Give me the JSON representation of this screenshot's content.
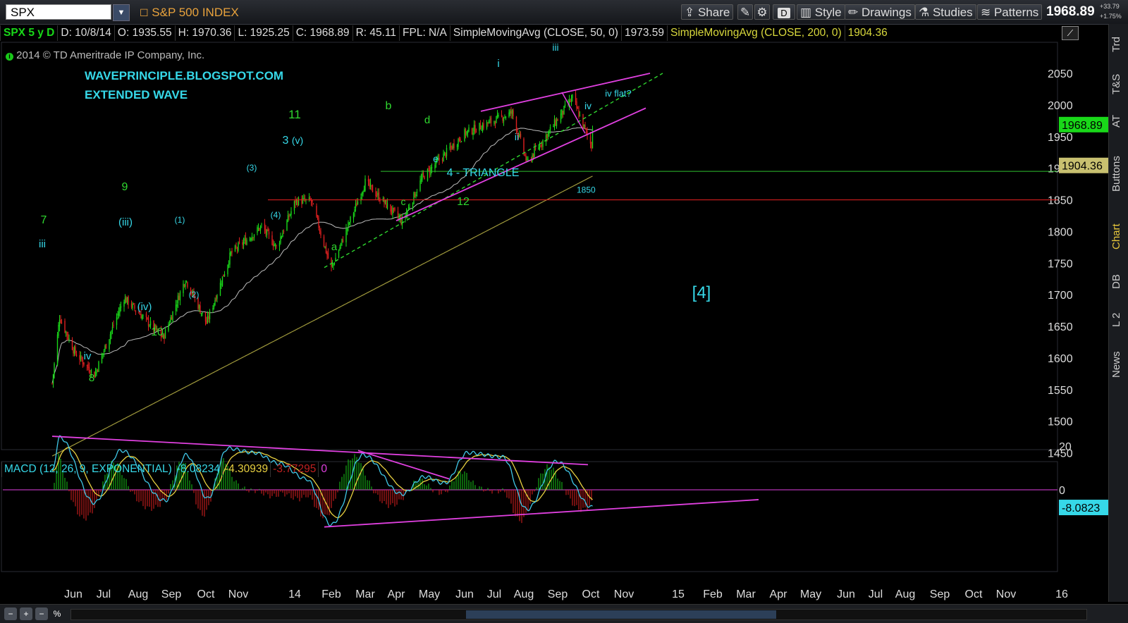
{
  "toolbar": {
    "symbol": "SPX",
    "description": "S&P 500 INDEX",
    "share": "Share",
    "d_badge": "D",
    "style": "Style",
    "drawings": "Drawings",
    "studies": "Studies",
    "patterns": "Patterns",
    "last_price": "1968.89",
    "change_pts": "+33.79",
    "change_pct": "+1.75%"
  },
  "infobar": {
    "symbol": "SPX 5 y D",
    "date": "D: 10/8/14",
    "open": "O: 1935.55",
    "high": "H: 1970.36",
    "low": "L: 1925.25",
    "close": "C: 1968.89",
    "range": "R: 45.11",
    "fpl": "FPL: N/A",
    "sma50_label": "SimpleMovingAvg (CLOSE, 50, 0)",
    "sma50_value": "1973.59",
    "sma200_label": "SimpleMovingAvg (CLOSE, 200, 0)",
    "sma200_value": "1904.36"
  },
  "side_tabs": [
    "Trd",
    "T&S",
    "AT",
    "Buttons",
    "Chart",
    "DB",
    "L 2",
    "News"
  ],
  "colors": {
    "price_up": "#19d819",
    "price_down": "#e02020",
    "sma50": "#bdbdbd",
    "sma200": "#a09a3c",
    "channel": "#e040e0",
    "level_green": "#2fbf2f",
    "level_red": "#d21e1e",
    "wave_green": "#2fd82f",
    "wave_cyan": "#36d8e8",
    "macd_line": "#40c8e8",
    "macd_avg": "#e8d040",
    "macd_hist_up": "#19c819",
    "macd_hist_down": "#e02020"
  },
  "chart_data": {
    "type": "candlestick",
    "title": "",
    "copyright": "2014 © TD Ameritrade IP Company, Inc.",
    "watermark_lines": [
      "WAVEPRINCIPLE.BLOGSPOT.COM",
      "EXTENDED WAVE"
    ],
    "y_ticks": [
      2050,
      2000,
      1950,
      1900,
      1850,
      1800,
      1750,
      1700,
      1650,
      1600,
      1550,
      1500,
      1450
    ],
    "ylim": [
      1410,
      2065
    ],
    "x_ticks": [
      "Jun",
      "Jul",
      "Aug",
      "Sep",
      "Oct",
      "Nov",
      "14",
      "Feb",
      "Mar",
      "Apr",
      "May",
      "Jun",
      "Jul",
      "Aug",
      "Sep",
      "Oct",
      "Nov",
      "15",
      "Feb",
      "Mar",
      "Apr",
      "May",
      "Jun",
      "Jul",
      "Aug",
      "Sep",
      "Oct",
      "Nov",
      "16"
    ],
    "price_path": [
      [
        "2013-05-15",
        1560
      ],
      [
        "2013-05-22",
        1665
      ],
      [
        "2013-06-05",
        1610
      ],
      [
        "2013-06-24",
        1573
      ],
      [
        "2013-07-22",
        1695
      ],
      [
        "2013-08-28",
        1632
      ],
      [
        "2013-09-18",
        1725
      ],
      [
        "2013-10-08",
        1655
      ],
      [
        "2013-10-31",
        1765
      ],
      [
        "2013-11-29",
        1808
      ],
      [
        "2013-12-13",
        1775
      ],
      [
        "2013-12-31",
        1848
      ],
      [
        "2014-01-15",
        1848
      ],
      [
        "2014-02-03",
        1741
      ],
      [
        "2014-03-07",
        1878
      ],
      [
        "2014-04-11",
        1815
      ],
      [
        "2014-04-30",
        1885
      ],
      [
        "2014-06-09",
        1955
      ],
      [
        "2014-07-24",
        1988
      ],
      [
        "2014-08-07",
        1908
      ],
      [
        "2014-09-19",
        2011
      ],
      [
        "2014-10-07",
        1935
      ],
      [
        "2014-10-08",
        1968.89
      ]
    ],
    "last_price_label": "1968.89",
    "sma200_label": "1904.36",
    "horizontal_levels": [
      {
        "value": 1895,
        "color": "green"
      },
      {
        "value": 1850,
        "color": "red",
        "label": "1850"
      }
    ],
    "wave_labels": [
      {
        "text": "7",
        "color": "green"
      },
      {
        "text": "iii",
        "color": "cyan"
      },
      {
        "text": "iv",
        "color": "cyan"
      },
      {
        "text": "8",
        "color": "green"
      },
      {
        "text": "9",
        "color": "green"
      },
      {
        "text": "(iii)",
        "color": "cyan"
      },
      {
        "text": "(iv)",
        "color": "cyan"
      },
      {
        "text": "10",
        "color": "green"
      },
      {
        "text": "(1)",
        "color": "cyan"
      },
      {
        "text": "(2)",
        "color": "cyan"
      },
      {
        "text": "(3)",
        "color": "cyan"
      },
      {
        "text": "(4)",
        "color": "cyan"
      },
      {
        "text": "3",
        "color": "cyan"
      },
      {
        "text": "(v)",
        "color": "cyan"
      },
      {
        "text": "11",
        "color": "green"
      },
      {
        "text": "a",
        "color": "green"
      },
      {
        "text": "b",
        "color": "green"
      },
      {
        "text": "c",
        "color": "green"
      },
      {
        "text": "d",
        "color": "green"
      },
      {
        "text": "e",
        "color": "cyan"
      },
      {
        "text": "12",
        "color": "green"
      },
      {
        "text": "4 - TRIANGLE",
        "color": "cyan"
      },
      {
        "text": "i",
        "color": "cyan"
      },
      {
        "text": "ii",
        "color": "cyan"
      },
      {
        "text": "iii",
        "color": "cyan"
      },
      {
        "text": "iv",
        "color": "cyan"
      },
      {
        "text": "iv flat?",
        "color": "cyan"
      },
      {
        "text": "[4]",
        "color": "cyan"
      }
    ]
  },
  "macd": {
    "header": "MACD (12, 26, 9, EXPONENTIAL)",
    "value": "-8.08234",
    "avg": "-4.30939",
    "diff": "-3.77295",
    "zero": "0",
    "y_ticks": [
      20,
      0
    ],
    "ylim": [
      -18,
      28
    ],
    "last_value_label": "-8.0823",
    "points": [
      [
        "2013-05-15",
        8
      ],
      [
        "2013-05-22",
        24
      ],
      [
        "2013-06-24",
        -6
      ],
      [
        "2013-07-19",
        18
      ],
      [
        "2013-08-30",
        -5
      ],
      [
        "2013-09-19",
        16
      ],
      [
        "2013-10-09",
        -4
      ],
      [
        "2013-10-28",
        19
      ],
      [
        "2013-11-22",
        17
      ],
      [
        "2013-12-16",
        12
      ],
      [
        "2014-01-10",
        5
      ],
      [
        "2014-02-03",
        -16
      ],
      [
        "2014-03-05",
        16
      ],
      [
        "2014-04-11",
        -2
      ],
      [
        "2014-05-02",
        6
      ],
      [
        "2014-05-21",
        3
      ],
      [
        "2014-06-12",
        17
      ],
      [
        "2014-07-15",
        15
      ],
      [
        "2014-08-07",
        -9
      ],
      [
        "2014-09-04",
        13
      ],
      [
        "2014-10-08",
        -8
      ]
    ]
  }
}
